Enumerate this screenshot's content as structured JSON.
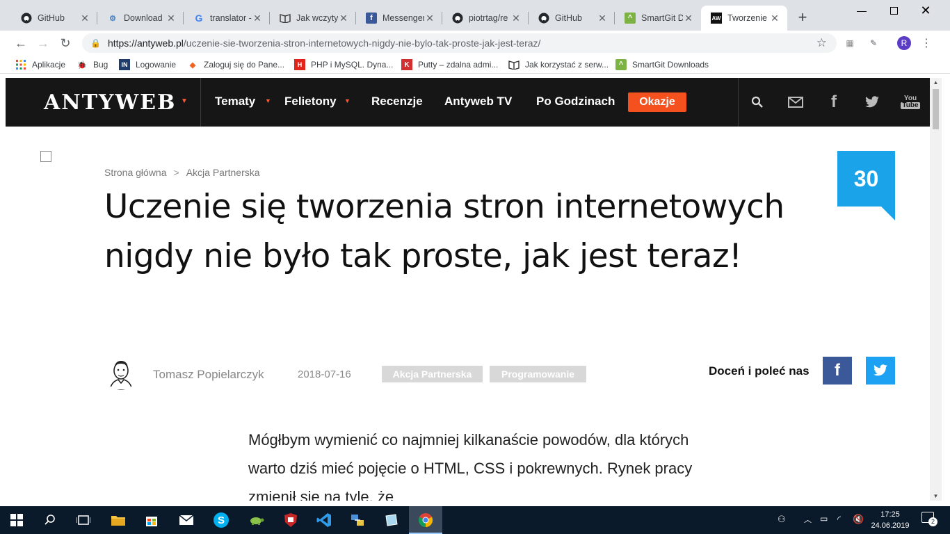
{
  "browser": {
    "tabs": [
      {
        "label": "GitHub",
        "icon": "github-icon"
      },
      {
        "label": "Download",
        "icon": "download-icon"
      },
      {
        "label": "translator -",
        "icon": "google-icon"
      },
      {
        "label": "Jak wczytyw",
        "icon": "book-icon"
      },
      {
        "label": "Messenger",
        "icon": "facebook-icon"
      },
      {
        "label": "piotrtag/re",
        "icon": "github-icon"
      },
      {
        "label": "GitHub",
        "icon": "github-icon"
      },
      {
        "label": "SmartGit D",
        "icon": "smartgit-icon"
      },
      {
        "label": "Tworzenie",
        "icon": "antyweb-icon",
        "active": true
      }
    ],
    "url_host": "https://antyweb.pl",
    "url_path": "/uczenie-sie-tworzenia-stron-internetowych-nigdy-nie-bylo-tak-proste-jak-jest-teraz/",
    "profile_initial": "R",
    "bookmarks": [
      {
        "label": "Aplikacje",
        "icon": "apps-icon"
      },
      {
        "label": "Bug",
        "icon": "bug-icon"
      },
      {
        "label": "Logowanie",
        "icon": "login-icon"
      },
      {
        "label": "Zaloguj się do Pane...",
        "icon": "magento-icon"
      },
      {
        "label": "PHP i MySQL. Dyna...",
        "icon": "helion-icon"
      },
      {
        "label": "Putty – zdalna admi...",
        "icon": "putty-icon"
      },
      {
        "label": "Jak korzystać z serw...",
        "icon": "book-icon"
      },
      {
        "label": "SmartGit Downloads",
        "icon": "smartgit-icon"
      }
    ]
  },
  "site": {
    "logo": "ANTYWEB",
    "nav": [
      "Tematy",
      "Felietony",
      "Recenzje",
      "Antyweb TV",
      "Po Godzinach"
    ],
    "okazje": "Okazje",
    "accent_color": "#f4511e"
  },
  "article": {
    "breadcrumb": [
      "Strona główna",
      "Akcja Partnerska"
    ],
    "breadcrumb_sep": ">",
    "title": "Uczenie się tworzenia stron internetowych nigdy nie było tak proste, jak jest teraz!",
    "comment_count": "30",
    "author": "Tomasz Popielarczyk",
    "date": "2018-07-16",
    "tags": [
      "Akcja Partnerska",
      "Programowanie"
    ],
    "share_label": "Doceń i poleć nas",
    "lead": "Mógłbym wymienić co najmniej kilkanaście powodów, dla których warto dziś mieć pojęcie o HTML, CSS i pokrewnych. Rynek pracy zmienił się na tyle, że"
  },
  "taskbar": {
    "time": "17:25",
    "date": "24.06.2019",
    "notifications": "2"
  }
}
